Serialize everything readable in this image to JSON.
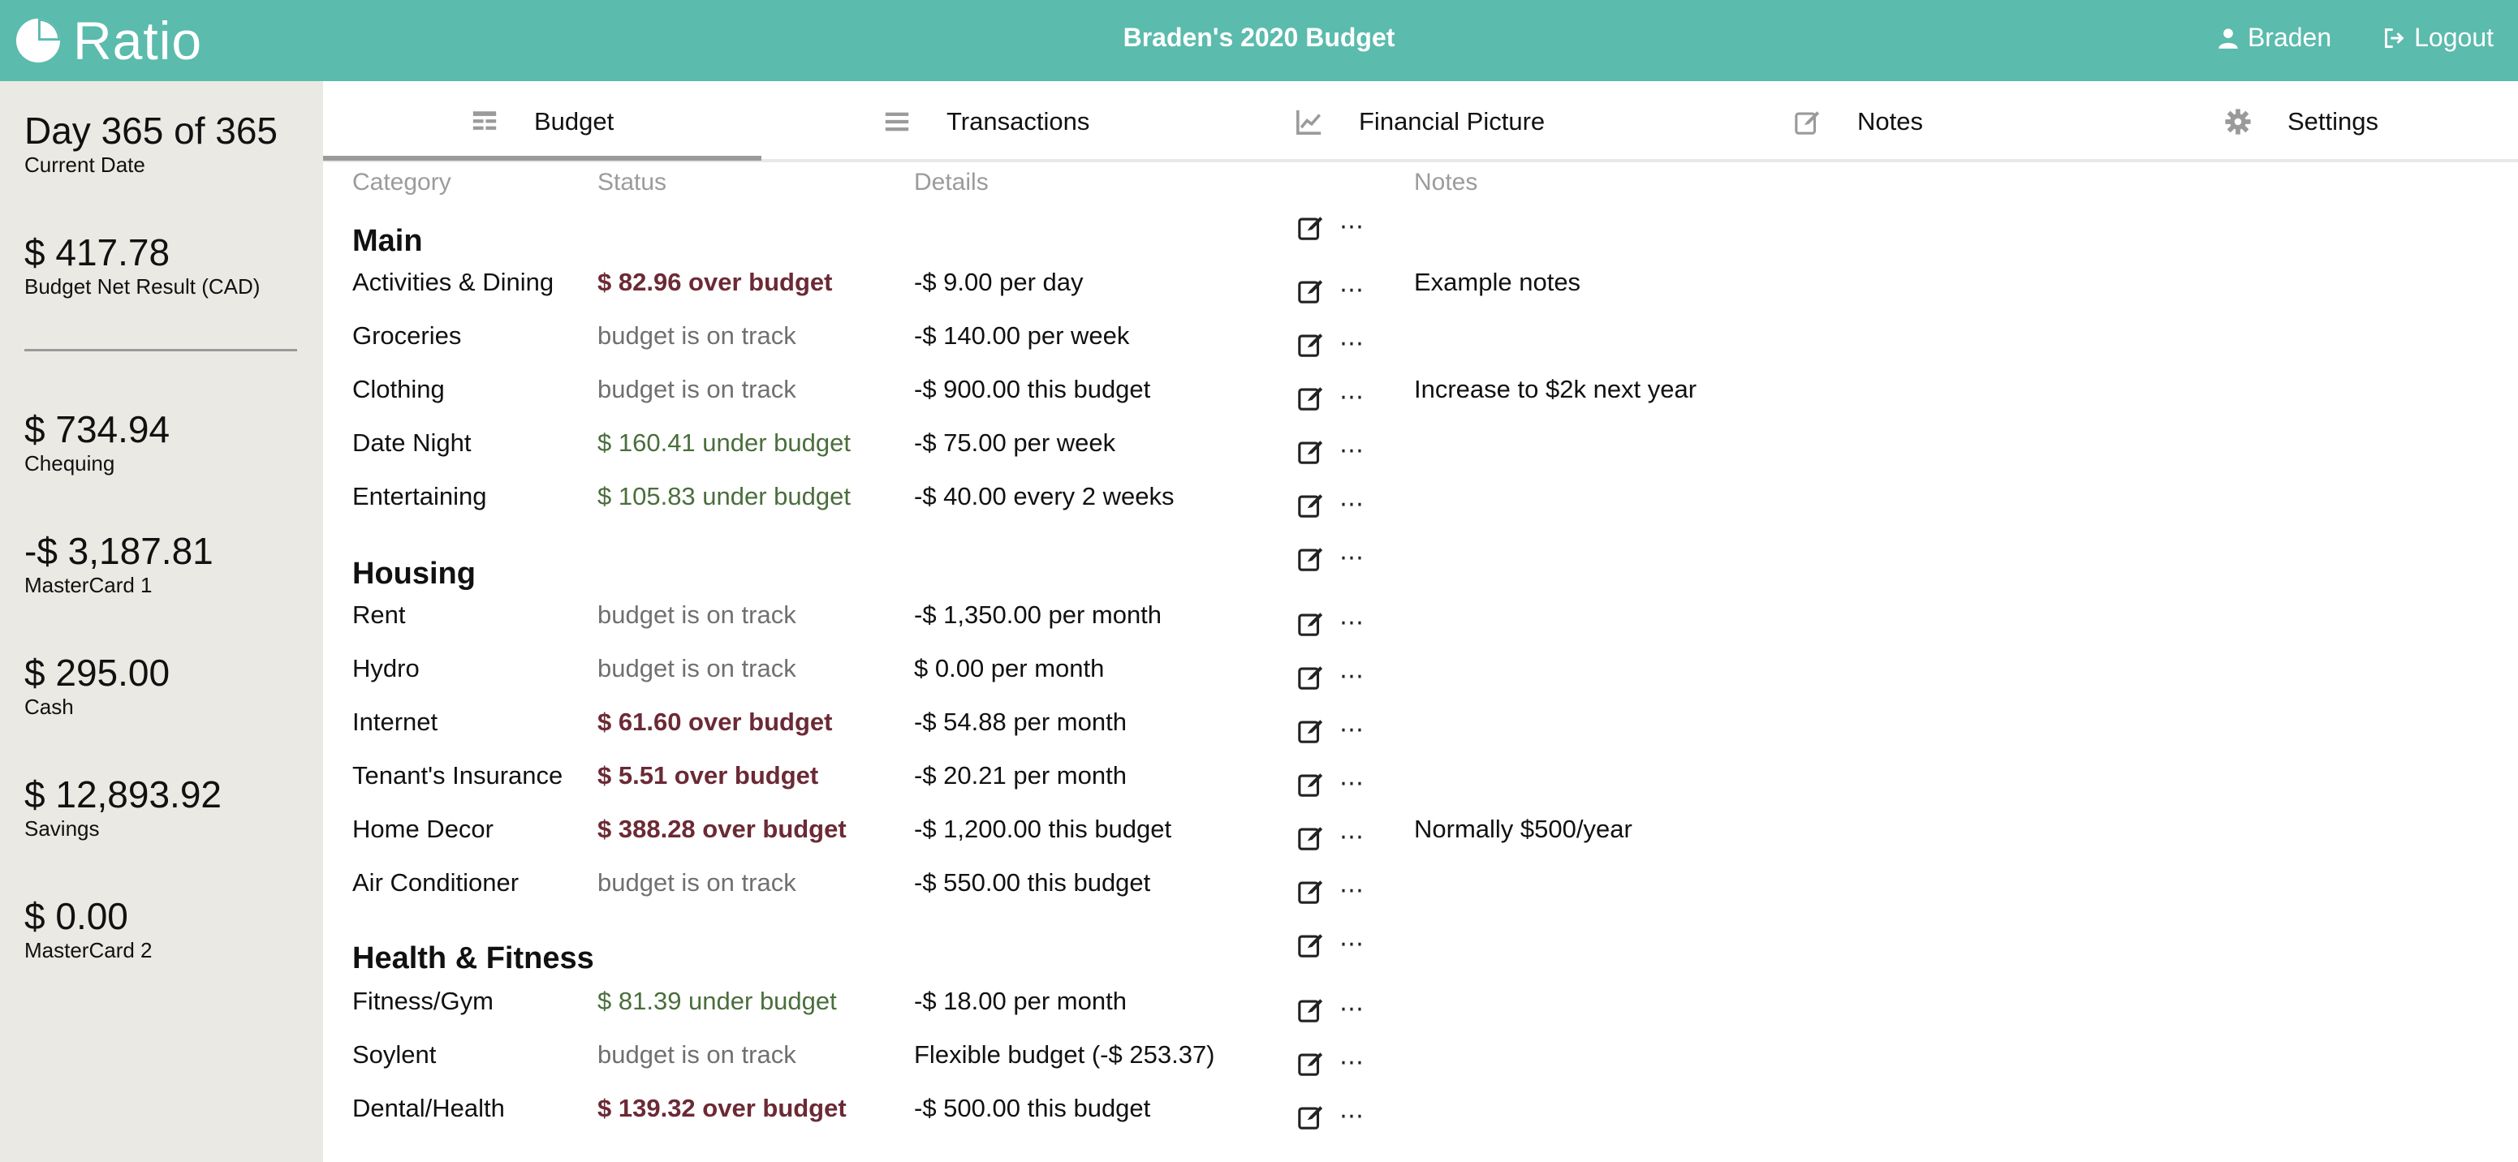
{
  "app": {
    "name": "Ratio",
    "title": "Braden's 2020 Budget"
  },
  "header": {
    "user_label": "Braden",
    "logout_label": "Logout"
  },
  "sidebar": {
    "date": {
      "value": "Day 365 of 365",
      "label": "Current Date"
    },
    "net": {
      "value": "$ 417.78",
      "label": "Budget Net Result (CAD)"
    },
    "accounts": [
      {
        "value": "$ 734.94",
        "label": "Chequing"
      },
      {
        "value": "-$ 3,187.81",
        "label": "MasterCard 1"
      },
      {
        "value": "$ 295.00",
        "label": "Cash"
      },
      {
        "value": "$ 12,893.92",
        "label": "Savings"
      },
      {
        "value": "$ 0.00",
        "label": "MasterCard 2"
      }
    ]
  },
  "tabs": [
    {
      "label": "Budget",
      "icon": "budget-icon",
      "active": true
    },
    {
      "label": "Transactions",
      "icon": "list-icon"
    },
    {
      "label": "Financial Picture",
      "icon": "chart-icon"
    },
    {
      "label": "Notes",
      "icon": "notes-icon"
    },
    {
      "label": "Settings",
      "icon": "gear-icon"
    }
  ],
  "columns": {
    "category": "Category",
    "status": "Status",
    "details": "Details",
    "notes": "Notes"
  },
  "groups": [
    {
      "name": "Main"
    },
    {
      "name": "Housing"
    },
    {
      "name": "Health & Fitness"
    }
  ],
  "rows": [
    {
      "category": "Activities & Dining",
      "status": "$ 82.96 over budget",
      "details": "-$ 9.00 per day",
      "notes": "Example notes"
    },
    {
      "category": "Groceries",
      "status": "budget is on track",
      "details": "-$ 140.00 per week",
      "notes": ""
    },
    {
      "category": "Clothing",
      "status": "budget is on track",
      "details": "-$ 900.00 this budget",
      "notes": "Increase to $2k next year"
    },
    {
      "category": "Date Night",
      "status": "$ 160.41 under budget",
      "details": "-$ 75.00 per week",
      "notes": ""
    },
    {
      "category": "Entertaining",
      "status": "$ 105.83 under budget",
      "details": "-$ 40.00 every 2 weeks",
      "notes": ""
    },
    {
      "category": "Rent",
      "status": "budget is on track",
      "details": "-$ 1,350.00 per month",
      "notes": ""
    },
    {
      "category": "Hydro",
      "status": "budget is on track",
      "details": "$ 0.00 per month",
      "notes": ""
    },
    {
      "category": "Internet",
      "status": "$ 61.60 over budget",
      "details": "-$ 54.88 per month",
      "notes": ""
    },
    {
      "category": "Tenant's Insurance",
      "status": "$ 5.51 over budget",
      "details": "-$ 20.21 per month",
      "notes": ""
    },
    {
      "category": "Home Decor",
      "status": "$ 388.28 over budget",
      "details": "-$ 1,200.00 this budget",
      "notes": "Normally $500/year"
    },
    {
      "category": "Air Conditioner",
      "status": "budget is on track",
      "details": "-$ 550.00 this budget",
      "notes": ""
    },
    {
      "category": "Fitness/Gym",
      "status": "$ 81.39 under budget",
      "details": "-$ 18.00 per month",
      "notes": ""
    },
    {
      "category": "Soylent",
      "status": "budget is on track",
      "details": "Flexible budget (-$ 253.37)",
      "notes": ""
    },
    {
      "category": "Dental/Health",
      "status": "$ 139.32 over budget",
      "details": "-$ 500.00 this budget",
      "notes": ""
    }
  ],
  "more_label": "⋯",
  "colors": {
    "header_bg": "#5bbbad",
    "sidebar_bg": "#ebe9e3",
    "over_budget": "#6b2a35",
    "under_budget": "#4a6e3c",
    "on_track": "#707070"
  }
}
